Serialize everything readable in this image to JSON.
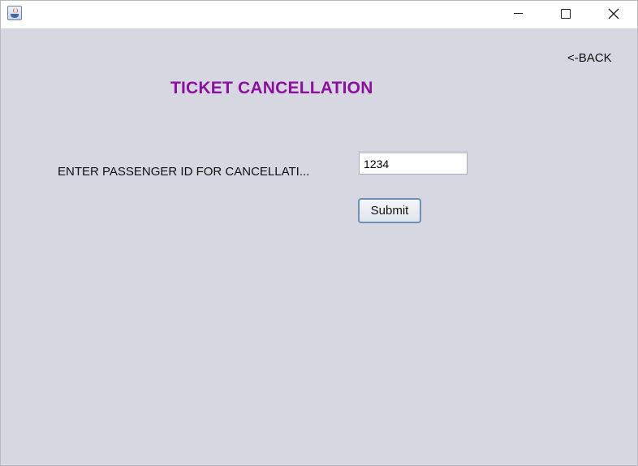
{
  "window": {
    "controls": {
      "minimize_icon": "minimize-icon",
      "maximize_icon": "maximize-icon",
      "close_icon": "close-icon"
    }
  },
  "header": {
    "back_label": "<-BACK",
    "title": "TICKET CANCELLATION",
    "title_color": "#8c0fa0"
  },
  "form": {
    "label": "ENTER PASSENGER ID FOR CANCELLATI...",
    "passenger_id_value": "1234",
    "submit_label": "Submit"
  },
  "colors": {
    "background": "#d6d7e0",
    "titlebar": "#ffffff"
  }
}
